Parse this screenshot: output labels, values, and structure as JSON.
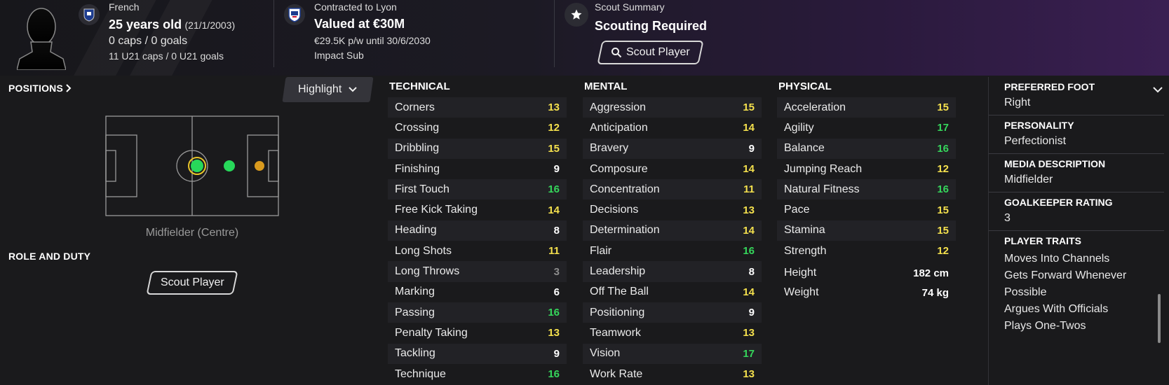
{
  "header": {
    "nationality": "French",
    "age": "25 years old",
    "dob": "(21/1/2003)",
    "caps": "0 caps / 0 goals",
    "u21": "11 U21 caps / 0 U21 goals",
    "contract_label": "Contracted to Lyon",
    "value": "Valued at €30M",
    "wage": "€29.5K p/w until 30/6/2030",
    "squad_status": "Impact Sub",
    "scout_label": "Scout Summary",
    "scout_status": "Scouting Required",
    "scout_button": "Scout Player"
  },
  "left": {
    "positions_title": "POSITIONS",
    "highlight_label": "Highlight",
    "position_name": "Midfielder (Centre)",
    "role_title": "ROLE AND DUTY",
    "role_button": "Scout Player"
  },
  "technical": {
    "title": "TECHNICAL",
    "rows": [
      {
        "name": "Corners",
        "value": "13",
        "tier": "yellow"
      },
      {
        "name": "Crossing",
        "value": "12",
        "tier": "yellow"
      },
      {
        "name": "Dribbling",
        "value": "15",
        "tier": "yellow"
      },
      {
        "name": "Finishing",
        "value": "9",
        "tier": "white"
      },
      {
        "name": "First Touch",
        "value": "16",
        "tier": "green"
      },
      {
        "name": "Free Kick Taking",
        "value": "14",
        "tier": "yellow"
      },
      {
        "name": "Heading",
        "value": "8",
        "tier": "white"
      },
      {
        "name": "Long Shots",
        "value": "11",
        "tier": "yellow"
      },
      {
        "name": "Long Throws",
        "value": "3",
        "tier": "grey"
      },
      {
        "name": "Marking",
        "value": "6",
        "tier": "white"
      },
      {
        "name": "Passing",
        "value": "16",
        "tier": "green"
      },
      {
        "name": "Penalty Taking",
        "value": "13",
        "tier": "yellow"
      },
      {
        "name": "Tackling",
        "value": "9",
        "tier": "white"
      },
      {
        "name": "Technique",
        "value": "16",
        "tier": "green"
      }
    ]
  },
  "mental": {
    "title": "MENTAL",
    "rows": [
      {
        "name": "Aggression",
        "value": "15",
        "tier": "yellow"
      },
      {
        "name": "Anticipation",
        "value": "14",
        "tier": "yellow"
      },
      {
        "name": "Bravery",
        "value": "9",
        "tier": "white"
      },
      {
        "name": "Composure",
        "value": "14",
        "tier": "yellow"
      },
      {
        "name": "Concentration",
        "value": "11",
        "tier": "yellow"
      },
      {
        "name": "Decisions",
        "value": "13",
        "tier": "yellow"
      },
      {
        "name": "Determination",
        "value": "14",
        "tier": "yellow"
      },
      {
        "name": "Flair",
        "value": "16",
        "tier": "green"
      },
      {
        "name": "Leadership",
        "value": "8",
        "tier": "white"
      },
      {
        "name": "Off The Ball",
        "value": "14",
        "tier": "yellow"
      },
      {
        "name": "Positioning",
        "value": "9",
        "tier": "white"
      },
      {
        "name": "Teamwork",
        "value": "13",
        "tier": "yellow"
      },
      {
        "name": "Vision",
        "value": "17",
        "tier": "green"
      },
      {
        "name": "Work Rate",
        "value": "13",
        "tier": "yellow"
      }
    ]
  },
  "physical": {
    "title": "PHYSICAL",
    "rows": [
      {
        "name": "Acceleration",
        "value": "15",
        "tier": "yellow"
      },
      {
        "name": "Agility",
        "value": "17",
        "tier": "green"
      },
      {
        "name": "Balance",
        "value": "16",
        "tier": "green"
      },
      {
        "name": "Jumping Reach",
        "value": "12",
        "tier": "yellow"
      },
      {
        "name": "Natural Fitness",
        "value": "16",
        "tier": "green"
      },
      {
        "name": "Pace",
        "value": "15",
        "tier": "yellow"
      },
      {
        "name": "Stamina",
        "value": "15",
        "tier": "yellow"
      },
      {
        "name": "Strength",
        "value": "12",
        "tier": "yellow"
      }
    ],
    "height_label": "Height",
    "height": "182 cm",
    "weight_label": "Weight",
    "weight": "74 kg"
  },
  "info": {
    "foot_title": "PREFERRED FOOT",
    "foot": "Right",
    "personality_title": "PERSONALITY",
    "personality": "Perfectionist",
    "media_title": "MEDIA DESCRIPTION",
    "media": "Midfielder",
    "gk_title": "GOALKEEPER RATING",
    "gk": "3",
    "traits_title": "PLAYER TRAITS",
    "traits": [
      "Moves Into Channels",
      "Gets Forward Whenever Possible",
      "Argues With Officials",
      "Plays One-Twos"
    ]
  },
  "colors": {
    "white": "#ffffff",
    "yellow": "#f4e04d",
    "green": "#35d65b",
    "grey": "#8c8c8c",
    "pos_primary": "#27d85a",
    "pos_secondary": "#d99a1e"
  }
}
